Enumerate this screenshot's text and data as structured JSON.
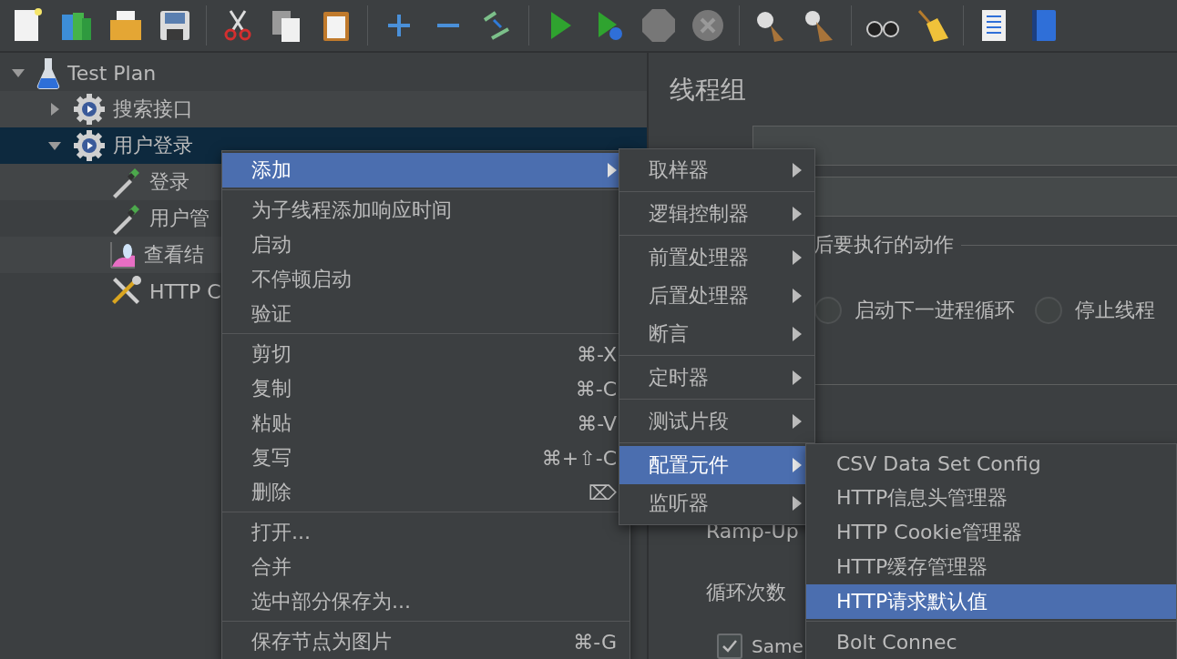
{
  "tree": {
    "items": [
      {
        "label": "Test Plan",
        "kind": "plan",
        "expanded": true,
        "selected": false,
        "children": [
          {
            "label": "搜索接口",
            "kind": "group",
            "expanded": false,
            "selected": false
          },
          {
            "label": "用户登录",
            "kind": "group",
            "expanded": true,
            "selected": true,
            "children": [
              {
                "label": "登录",
                "kind": "sampler",
                "selected": false
              },
              {
                "label": "用户管",
                "kind": "sampler",
                "selected": false
              },
              {
                "label": "查看结",
                "kind": "listener",
                "selected": false
              },
              {
                "label": "HTTP C",
                "kind": "config",
                "selected": false
              }
            ]
          }
        ]
      }
    ]
  },
  "panel": {
    "title": "线程组",
    "action_legend": "后要执行的动作",
    "radios": [
      {
        "label": "启动下一进程循环",
        "selected": false
      },
      {
        "label": "停止线程",
        "selected": false
      }
    ],
    "ramp_label": "Ramp-Up",
    "loop_label": "循环次数",
    "same_checkbox": {
      "label": "Same",
      "checked": true
    }
  },
  "context_menu": {
    "items": [
      {
        "kind": "item",
        "label": "添加",
        "selected": true,
        "submenu": true
      },
      {
        "kind": "separator"
      },
      {
        "kind": "item",
        "label": "为子线程添加响应时间",
        "selected": false
      },
      {
        "kind": "item",
        "label": "启动",
        "selected": false
      },
      {
        "kind": "item",
        "label": "不停顿启动",
        "selected": false
      },
      {
        "kind": "item",
        "label": "验证",
        "selected": false
      },
      {
        "kind": "separator"
      },
      {
        "kind": "item",
        "label": "剪切",
        "selected": false,
        "shortcut": "⌘-X"
      },
      {
        "kind": "item",
        "label": "复制",
        "selected": false,
        "shortcut": "⌘-C"
      },
      {
        "kind": "item",
        "label": "粘贴",
        "selected": false,
        "shortcut": "⌘-V"
      },
      {
        "kind": "item",
        "label": "复写",
        "selected": false,
        "shortcut": "⌘+⇧-C"
      },
      {
        "kind": "item",
        "label": "删除",
        "selected": false,
        "shortcut": "⌦"
      },
      {
        "kind": "separator"
      },
      {
        "kind": "item",
        "label": "打开...",
        "selected": false
      },
      {
        "kind": "item",
        "label": "合并",
        "selected": false
      },
      {
        "kind": "item",
        "label": "选中部分保存为...",
        "selected": false
      },
      {
        "kind": "separator"
      },
      {
        "kind": "item",
        "label": "保存节点为图片",
        "selected": false,
        "shortcut": "⌘-G"
      }
    ]
  },
  "add_submenu": {
    "items": [
      {
        "kind": "item",
        "label": "取样器",
        "selected": false,
        "submenu": true
      },
      {
        "kind": "separator"
      },
      {
        "kind": "item",
        "label": "逻辑控制器",
        "selected": false,
        "submenu": true
      },
      {
        "kind": "separator"
      },
      {
        "kind": "item",
        "label": "前置处理器",
        "selected": false,
        "submenu": true
      },
      {
        "kind": "item",
        "label": "后置处理器",
        "selected": false,
        "submenu": true
      },
      {
        "kind": "item",
        "label": "断言",
        "selected": false,
        "submenu": true
      },
      {
        "kind": "separator"
      },
      {
        "kind": "item",
        "label": "定时器",
        "selected": false,
        "submenu": true
      },
      {
        "kind": "separator"
      },
      {
        "kind": "item",
        "label": "测试片段",
        "selected": false,
        "submenu": true
      },
      {
        "kind": "separator"
      },
      {
        "kind": "item",
        "label": "配置元件",
        "selected": true,
        "submenu": true
      },
      {
        "kind": "item",
        "label": "监听器",
        "selected": false,
        "submenu": true
      }
    ]
  },
  "config_submenu": {
    "items": [
      {
        "kind": "item",
        "label": "CSV Data Set Config",
        "selected": false
      },
      {
        "kind": "item",
        "label": "HTTP信息头管理器",
        "selected": false
      },
      {
        "kind": "item",
        "label": "HTTP Cookie管理器",
        "selected": false
      },
      {
        "kind": "item",
        "label": "HTTP缓存管理器",
        "selected": false
      },
      {
        "kind": "item",
        "label": "HTTP请求默认值",
        "selected": true
      },
      {
        "kind": "separator"
      },
      {
        "kind": "item",
        "label": "Bolt Connec",
        "selected": false
      }
    ]
  }
}
